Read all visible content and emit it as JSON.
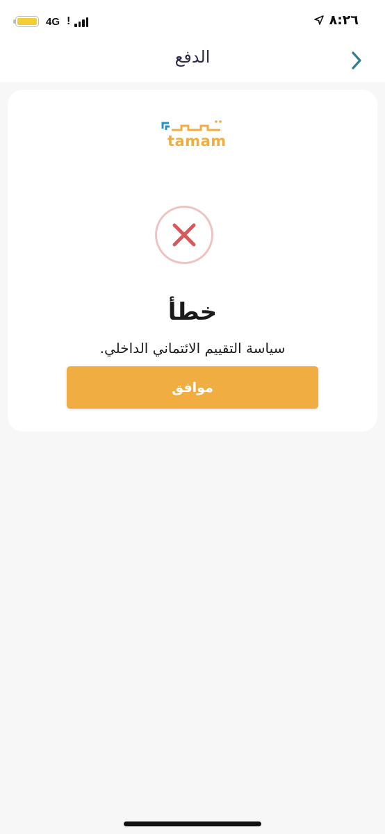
{
  "status_bar": {
    "time": "٨:٢٦",
    "network": "4G",
    "battery_color": "#f5cc3a",
    "icons": [
      "battery-icon",
      "signal-icon",
      "location-arrow-icon"
    ]
  },
  "header": {
    "title": "الدفع",
    "back_icon": "chevron-right-icon"
  },
  "logo": {
    "arabic": "تمام",
    "latin": "tamam",
    "brand_color": "#f0ad42",
    "accent_color": "#2a8fc2"
  },
  "dialog": {
    "icon": "close-icon",
    "icon_color": "#d9595b",
    "title": "خطأ",
    "message": "سياسة التقييم الائتماني الداخلي.",
    "ok_label": "موافق",
    "button_color": "#f0ad42"
  }
}
